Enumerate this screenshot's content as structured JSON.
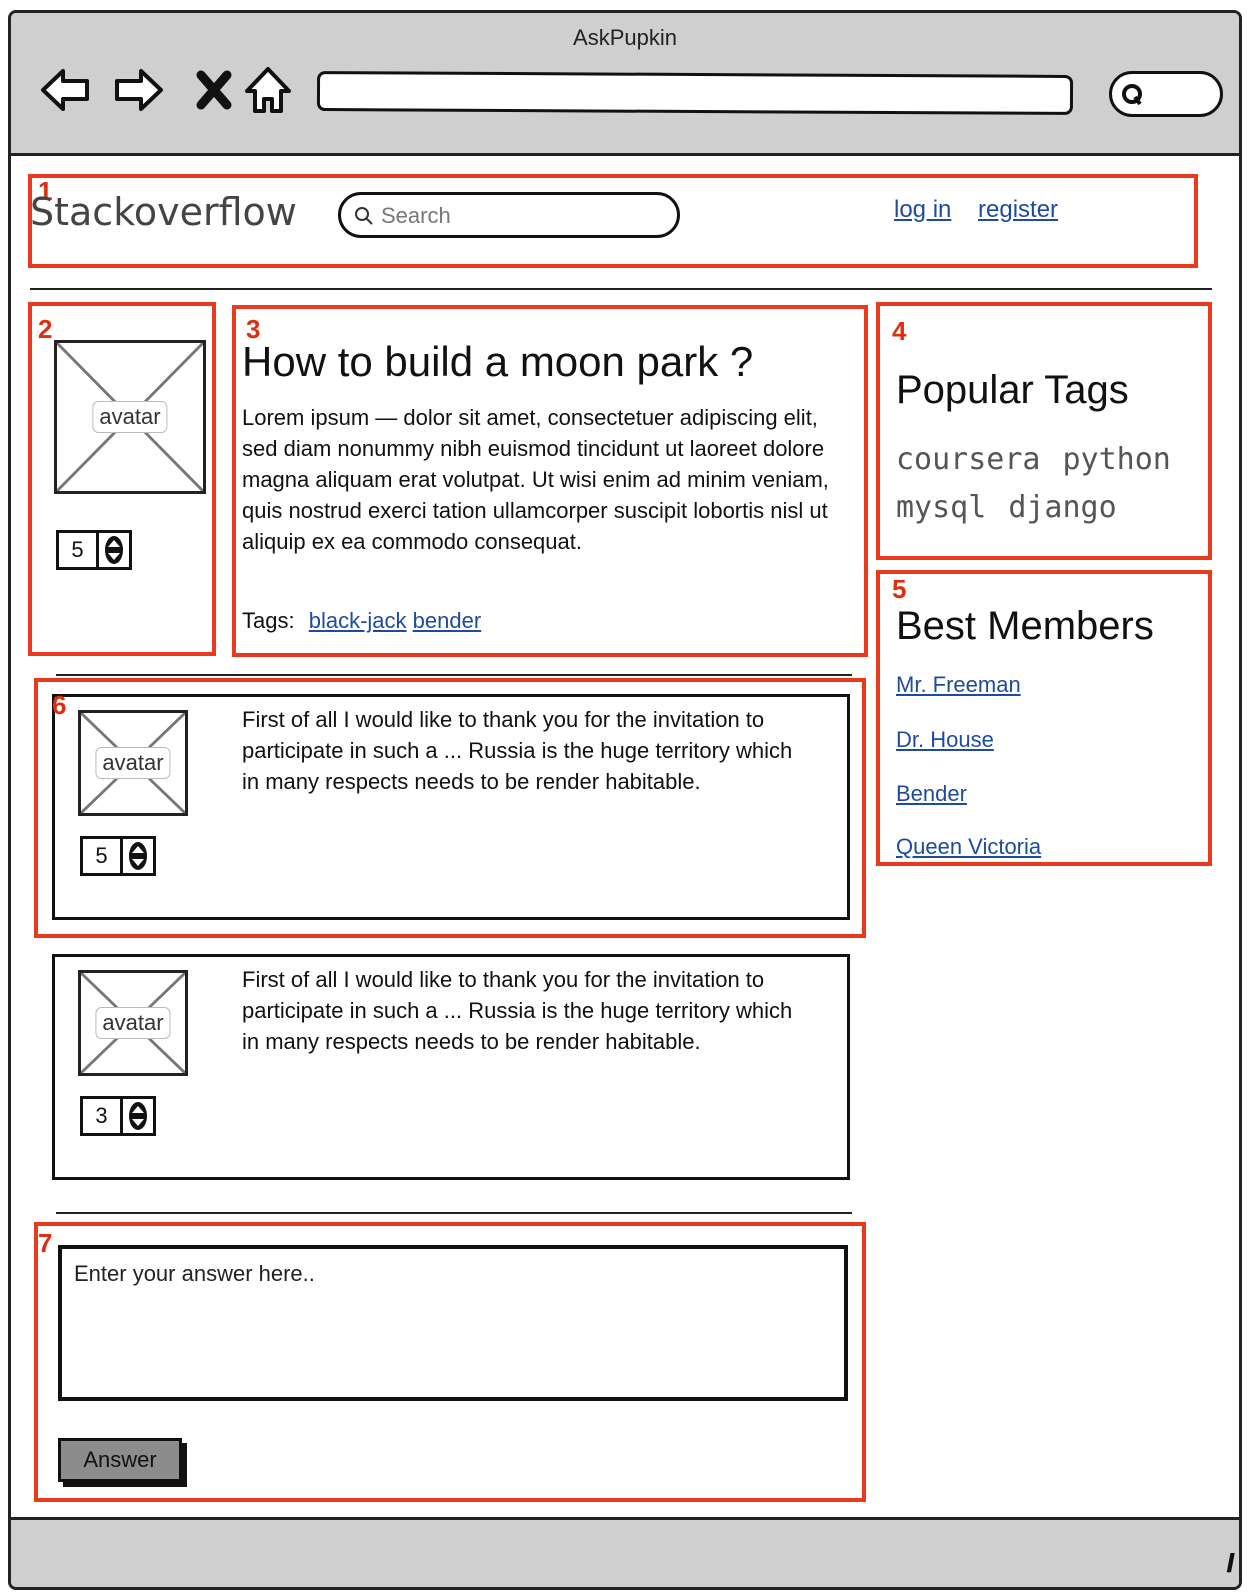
{
  "window": {
    "title": "AskPupkin"
  },
  "header": {
    "logo": "Stackoverflow",
    "search_placeholder": "Search",
    "login": "log in",
    "register": "register"
  },
  "regions": [
    "1",
    "2",
    "3",
    "4",
    "5",
    "6",
    "7"
  ],
  "question": {
    "title": "How to build a moon park ?",
    "body": "Lorem ipsum — dolor sit amet, consectetuer adipiscing elit, sed diam nonummy nibh euismod tincidunt ut laoreet dolore magna aliquam erat volutpat. Ut wisi enim ad minim veniam, quis nostrud exerci tation ullamcorper suscipit lobortis nisl ut aliquip ex ea commodo consequat.",
    "tags_label": "Tags:",
    "tags": [
      "black-jack",
      "bender"
    ],
    "avatar_label": "avatar",
    "rating": "5"
  },
  "sidebar": {
    "popular_title": "Popular Tags",
    "popular_tags": [
      "coursera",
      "python",
      "mysql",
      "django"
    ],
    "members_title": "Best Members",
    "members": [
      "Mr. Freeman",
      "Dr. House",
      "Bender",
      "Queen Victoria"
    ]
  },
  "answers": [
    {
      "avatar_label": "avatar",
      "rating": "5",
      "text": "First of all I would like to thank you for the invitation to participate in such a ... Russia is the huge territory which in many respects needs to be render habitable."
    },
    {
      "avatar_label": "avatar",
      "rating": "3",
      "text": "First of all I would like to thank you for the invitation to participate in such a ... Russia is the huge territory which in many respects needs to be render habitable."
    }
  ],
  "answer_form": {
    "placeholder": "Enter your answer here..",
    "submit_label": "Answer"
  },
  "colors": {
    "region_outline": "#ea3a1c",
    "link": "#1e4b9e",
    "chrome": "#cfcfcf"
  }
}
